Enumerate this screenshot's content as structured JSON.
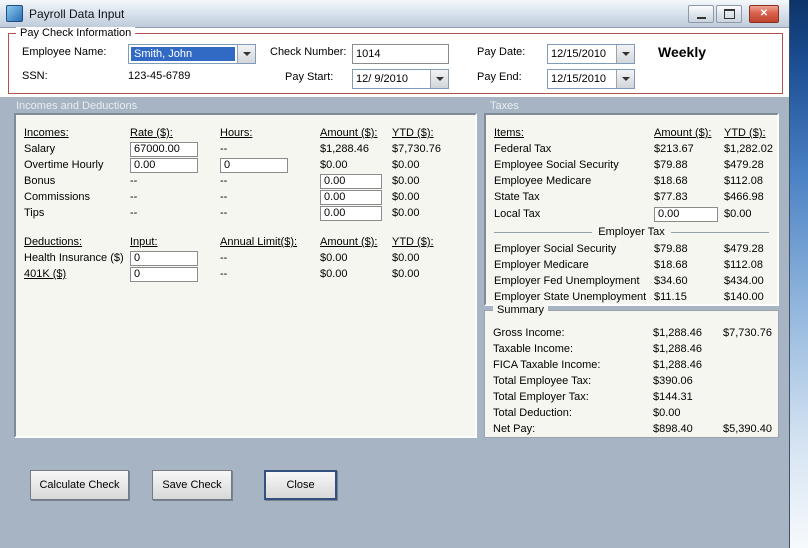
{
  "window": {
    "title": "Payroll Data Input"
  },
  "icons": {
    "close": "✕",
    "dropdown": "▼"
  },
  "paycheck": {
    "group_title": "Pay Check Information",
    "employee_name_label": "Employee Name:",
    "employee_name_value": "Smith, John",
    "ssn_label": "SSN:",
    "ssn_value": "123-45-6789",
    "check_number_label": "Check Number:",
    "check_number_value": "1014",
    "pay_start_label": "Pay Start:",
    "pay_start_value": "12/ 9/2010",
    "pay_date_label": "Pay Date:",
    "pay_date_value": "12/15/2010",
    "pay_end_label": "Pay End:",
    "pay_end_value": "12/15/2010",
    "frequency": "Weekly"
  },
  "section_headers": {
    "left": "Incomes and Deductions",
    "right": "Taxes"
  },
  "incomes": {
    "headers": {
      "items": "Incomes:",
      "rate": "Rate ($):",
      "hours": "Hours:",
      "amount": "Amount ($):",
      "ytd": "YTD ($):"
    },
    "salary": {
      "label": "Salary",
      "rate": "67000.00",
      "hours": "--",
      "amount": "$1,288.46",
      "ytd": "$7,730.76"
    },
    "overtime": {
      "label": "Overtime Hourly",
      "rate": "0.00",
      "hours": "0",
      "amount": "$0.00",
      "ytd": "$0.00"
    },
    "bonus": {
      "label": "Bonus",
      "rate": "--",
      "hours": "--",
      "amount": "0.00",
      "ytd": "$0.00"
    },
    "commissions": {
      "label": "Commissions",
      "rate": "--",
      "hours": "--",
      "amount": "0.00",
      "ytd": "$0.00"
    },
    "tips": {
      "label": "Tips",
      "rate": "--",
      "hours": "--",
      "amount": "0.00",
      "ytd": "$0.00"
    }
  },
  "deductions": {
    "headers": {
      "items": "Deductions:",
      "input": "Input:",
      "limit": "Annual Limit($):",
      "amount": "Amount ($):",
      "ytd": "YTD ($):"
    },
    "health": {
      "label": "Health Insurance  ($)",
      "input": "0",
      "limit": "--",
      "amount": "$0.00",
      "ytd": "$0.00"
    },
    "k401": {
      "label": "401K  ($)",
      "input": "0",
      "limit": "--",
      "amount": "$0.00",
      "ytd": "$0.00"
    }
  },
  "taxes": {
    "headers": {
      "items": "Items:",
      "amount": "Amount ($):",
      "ytd": "YTD ($):"
    },
    "rows": [
      {
        "label": "Federal Tax",
        "amount": "$213.67",
        "ytd": "$1,282.02"
      },
      {
        "label": "Employee Social Security",
        "amount": "$79.88",
        "ytd": "$479.28"
      },
      {
        "label": "Employee Medicare",
        "amount": "$18.68",
        "ytd": "$112.08"
      },
      {
        "label": "State Tax",
        "amount": "$77.83",
        "ytd": "$466.98"
      }
    ],
    "local": {
      "label": "Local Tax",
      "amount": "0.00",
      "ytd": "$0.00"
    },
    "employer_divider": "Employer Tax",
    "employer_rows": [
      {
        "label": "Employer Social Security",
        "amount": "$79.88",
        "ytd": "$479.28"
      },
      {
        "label": "Employer Medicare",
        "amount": "$18.68",
        "ytd": "$112.08"
      },
      {
        "label": "Employer Fed Unemployment",
        "amount": "$34.60",
        "ytd": "$434.00"
      },
      {
        "label": "Employer State Unemployment",
        "amount": "$11.15",
        "ytd": "$140.00"
      }
    ]
  },
  "summary": {
    "group_title": "Summary",
    "rows": [
      {
        "label": "Gross Income:",
        "amount": "$1,288.46",
        "ytd": "$7,730.76"
      },
      {
        "label": "Taxable Income:",
        "amount": "$1,288.46",
        "ytd": ""
      },
      {
        "label": "FICA Taxable Income:",
        "amount": "$1,288.46",
        "ytd": ""
      },
      {
        "label": "Total Employee Tax:",
        "amount": "$390.06",
        "ytd": ""
      },
      {
        "label": "Total Employer Tax:",
        "amount": "$144.31",
        "ytd": ""
      },
      {
        "label": "Total Deduction:",
        "amount": "$0.00",
        "ytd": ""
      },
      {
        "label": "Net Pay:",
        "amount": "$898.40",
        "ytd": "$5,390.40"
      }
    ]
  },
  "buttons": {
    "calculate": "Calculate Check",
    "save": "Save Check",
    "close": "Close"
  }
}
